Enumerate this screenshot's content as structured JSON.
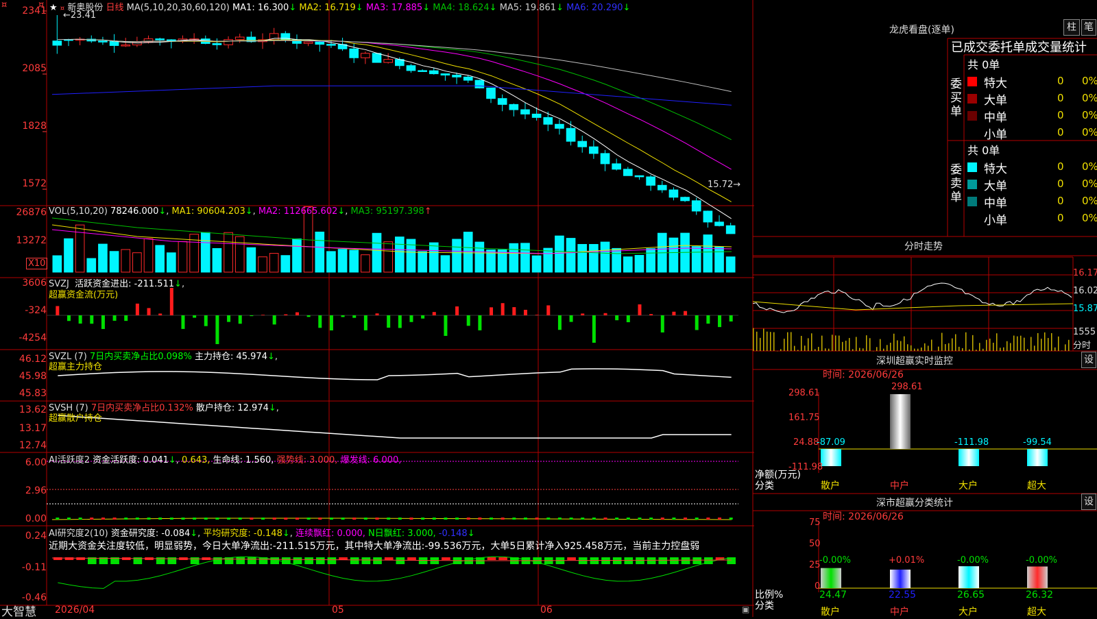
{
  "colors": {
    "up": "#ff2a2a",
    "down": "#00f5ff",
    "grid": "#b40000",
    "ma1": "#ffffff",
    "ma2": "#f0e000",
    "ma3": "#ff00ff",
    "ma4": "#00c000",
    "ma5": "#c0c0c0",
    "ma6": "#2020ff",
    "bar_green": "#00e000",
    "bar_red": "#ff1c1c"
  },
  "main": {
    "stock_name": "新奥股份",
    "period": "日线",
    "ma_label": "MA(5,10,20,30,60,120)",
    "ma1": "MA1: 16.300",
    "ma2": "MA2: 16.719",
    "ma3": "MA3: 17.885",
    "ma4": "MA4: 18.624",
    "ma5": "MA5: 19.861",
    "ma6": "MA6: 20.290",
    "arrow": "↓",
    "high_note": "←23.41",
    "low_note": "15.72→",
    "y_ticks": [
      "2341",
      "2085",
      "1828",
      "1572"
    ]
  },
  "vol": {
    "label": "VOL(5,10,20)",
    "v": "78246.000",
    "ma1": "MA1: 90604.203",
    "ma2": "MA2: 112665.602",
    "ma3": "MA3: 95197.398",
    "ma3_arrow": "↑",
    "y_ticks": [
      "26876",
      "13272"
    ],
    "unit": "X10"
  },
  "svzj": {
    "label": "SVZJ",
    "desc": "活跃资金进出: -211.511",
    "sub": "超赢资金流(万元)",
    "y_ticks": [
      "3606",
      "-324",
      "-4254"
    ]
  },
  "svzl": {
    "label": "SVZL (7)",
    "desc1": "7日内买卖净占比0.098%",
    "desc2": "主力持仓: 45.974",
    "sub": "超赢主力持仓",
    "y_ticks": [
      "46.12",
      "45.98",
      "45.83"
    ]
  },
  "svsh": {
    "label": "SVSH (7)",
    "desc1": "7日内买卖净占比0.132%",
    "desc2": "散户持仓: 12.974",
    "sub": "超赢散户持仓",
    "y_ticks": [
      "13.62",
      "13.17",
      "12.74"
    ]
  },
  "ai1": {
    "label": "AI活跃度2",
    "a": "资金活跃度: 0.041",
    "b": "0.643,",
    "c": "生命线: 1.560,",
    "d": "强势线: 3.000,",
    "e": "爆发线: 6.000,",
    "y_ticks": [
      "6.00",
      "2.96",
      "0.00"
    ]
  },
  "ai2": {
    "label": "AI研究度2(10)",
    "a": "资金研究度: -0.084",
    "b": "平均研究度: -0.148",
    "c": "连续飘红: 0.000,",
    "d": "N日飘红: 3.000,",
    "e": "-0.148",
    "comment": "近期大资金关注度较低，明显弱势，今日大单净流出:-211.515万元，其中特大单净流出:-99.536万元，大单5日累计净入925.458万元，当前主力控盘弱",
    "y_ticks": [
      "0.24",
      "-0.11",
      "-0.46"
    ]
  },
  "bottom": {
    "brand": "大智慧",
    "date_start": "2026/04",
    "m05": "05",
    "m06": "06"
  },
  "top_left_markers": [
    "¤",
    "¤"
  ],
  "longhu": {
    "title": "龙虎看盘(逐单)",
    "btn1": "柱",
    "btn2": "笔",
    "header": "已成交委托单成交量统计",
    "buy_label": "委买单",
    "sell_label": "委卖单",
    "buy_total": "共 0单",
    "sell_total": "共 0单",
    "buy_rows": [
      {
        "name": "特大",
        "val": "0",
        "pct": "0%",
        "color": "#ff0000"
      },
      {
        "name": "大单",
        "val": "0",
        "pct": "0%",
        "color": "#9a0000"
      },
      {
        "name": "中单",
        "val": "0",
        "pct": "0%",
        "color": "#6a0000"
      },
      {
        "name": "小单",
        "val": "0",
        "pct": "0%",
        "color": "#000000"
      }
    ],
    "sell_rows": [
      {
        "name": "特大",
        "val": "0",
        "pct": "0%",
        "color": "#00f5ff"
      },
      {
        "name": "大单",
        "val": "0",
        "pct": "0%",
        "color": "#009a9a"
      },
      {
        "name": "中单",
        "val": "0",
        "pct": "0%",
        "color": "#007a7a"
      },
      {
        "name": "小单",
        "val": "0",
        "pct": "0%",
        "color": "#000000"
      }
    ]
  },
  "fenshi": {
    "title": "分时走势",
    "y_ticks": [
      "16.17",
      "16.02",
      "15.87",
      "1555",
      "分时"
    ]
  },
  "monitor": {
    "title": "深圳超赢实时监控",
    "btn": "设",
    "time": "时间: 2026/06/26",
    "y_ticks": [
      "298.61",
      "161.75",
      "24.88",
      "-111.98"
    ],
    "top_value": "298.61",
    "ylabel": "净额(万元)",
    "xlabel": "分类",
    "cats": [
      "散户",
      "中户",
      "大户",
      "超大"
    ],
    "values": [
      -87.09,
      298.61,
      -111.98,
      -99.54
    ],
    "value_labels": [
      "-87.09",
      "",
      "-111.98",
      "-99.54"
    ]
  },
  "classify": {
    "title": "深市超赢分类统计",
    "btn": "设",
    "time": "时间: 2026/06/26",
    "y_ticks": [
      "75",
      "50",
      "25",
      "0"
    ],
    "ylabel": "比例%",
    "xlabel": "分类",
    "cats": [
      "散户",
      "中户",
      "大户",
      "超大"
    ],
    "changes": [
      "-0.00%",
      "+0.01%",
      "-0.00%",
      "-0.00%"
    ],
    "values": [
      "24.47",
      "22.55",
      "26.65",
      "26.32"
    ]
  }
}
